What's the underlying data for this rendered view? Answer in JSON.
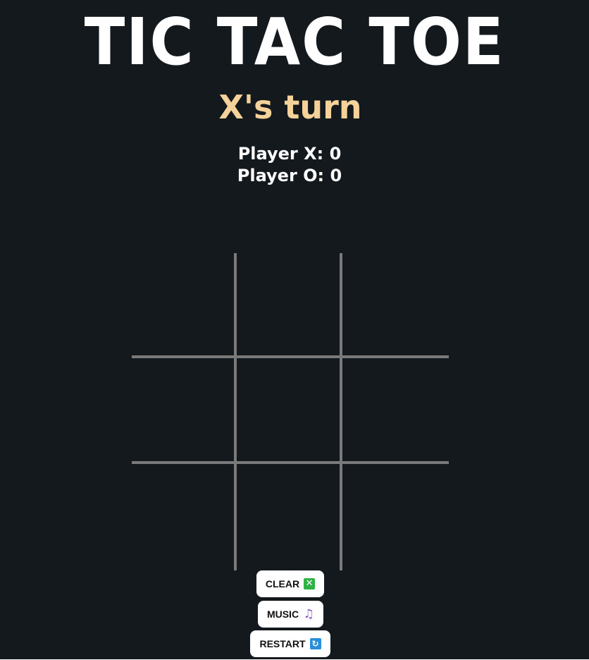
{
  "game": {
    "title": "TIC TAC TOE",
    "turn_text": "X's turn"
  },
  "score": {
    "player_x": "Player X: 0",
    "player_o": "Player O: 0"
  },
  "board": {
    "cells": [
      "",
      "",
      "",
      "",
      "",
      "",
      "",
      "",
      ""
    ]
  },
  "controls": {
    "clear_label": "CLEAR",
    "clear_icon": "✕",
    "music_label": "MUSIC",
    "music_icon": "♫",
    "restart_label": "RESTART",
    "restart_icon": "↻"
  },
  "colors": {
    "background": "#14191e",
    "title": "#ffffff",
    "turn": "#f4d29a",
    "grid": "#7a7a7a",
    "clear_icon": "#2fb344",
    "music_icon": "#8a5cc9",
    "restart_icon": "#2a8fd8"
  }
}
